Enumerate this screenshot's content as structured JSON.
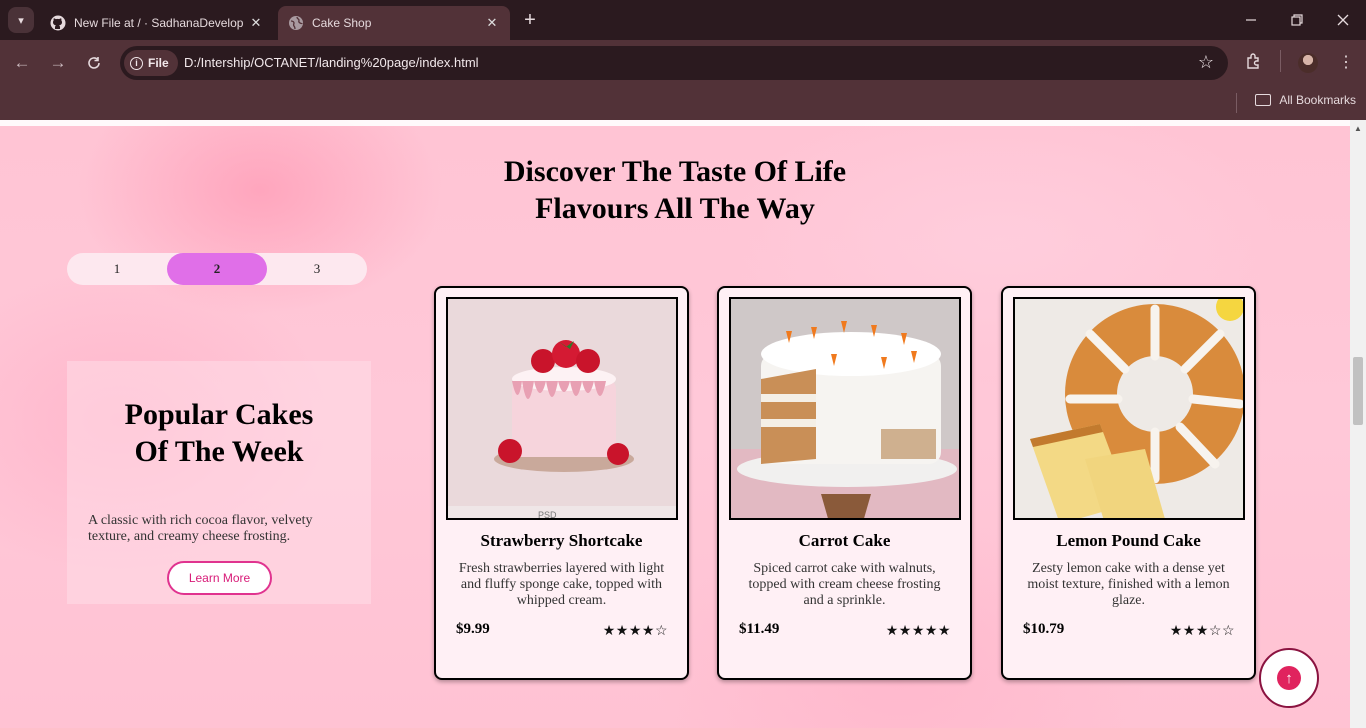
{
  "browser": {
    "tabs": [
      {
        "title": "New File at / · SadhanaDevelop",
        "icon": "github-icon",
        "active": false
      },
      {
        "title": "Cake Shop",
        "icon": "globe-icon",
        "active": true
      }
    ],
    "url_chip": "File",
    "url": "D:/Intership/OCTANET/landing%20page/index.html",
    "bookmarks_label": "All Bookmarks"
  },
  "page": {
    "heading_line1": "Discover The Taste Of Life",
    "heading_line2": "Flavours All The Way",
    "pager": [
      "1",
      "2",
      "3"
    ],
    "pager_active": "2",
    "promo": {
      "title_line1": "Popular Cakes",
      "title_line2": "Of The Week",
      "description": "A classic with rich cocoa flavor, velvety texture, and creamy cheese frosting.",
      "button": "Learn More"
    },
    "cards": [
      {
        "name": "Strawberry Shortcake",
        "description": "Fresh strawberries layered with light and fluffy sponge cake, topped with whipped cream.",
        "price": "$9.99",
        "rating": "★★★★☆",
        "rating_value": 4
      },
      {
        "name": "Carrot Cake",
        "description": "Spiced carrot cake with walnuts, topped with cream cheese frosting and a sprinkle.",
        "price": "$11.49",
        "rating": "★★★★★",
        "rating_value": 5
      },
      {
        "name": "Lemon Pound Cake",
        "description": "Zesty lemon cake with a dense yet moist texture, finished with a lemon glaze.",
        "price": "$10.79",
        "rating": "★★★☆☆",
        "rating_value": 3
      }
    ],
    "image_watermark": "PSD"
  },
  "colors": {
    "accent_pink": "#e0338f",
    "pager_active": "#e06fe8",
    "back_to_top": "#e0235e"
  }
}
